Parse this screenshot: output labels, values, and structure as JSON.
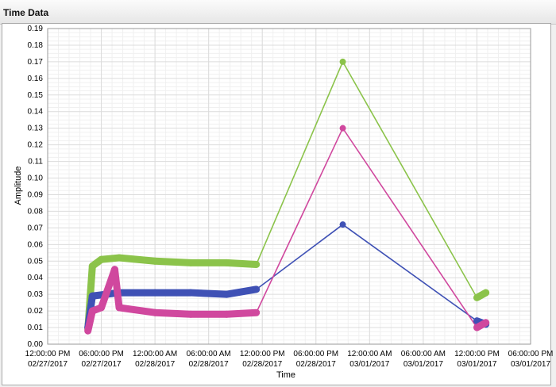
{
  "panel": {
    "title": "Time Data"
  },
  "chart_data": {
    "type": "scatter",
    "xlabel": "Time",
    "ylabel": "Amplitude",
    "xlim": [
      "2017-02-27 12:00",
      "2017-03-01 18:00"
    ],
    "ylim": [
      0,
      0.19
    ],
    "grid": true,
    "legend": "none",
    "x_ticks": [
      {
        "time": "2017-02-27 12:00",
        "l1": "12:00:00 PM",
        "l2": "02/27/2017"
      },
      {
        "time": "2017-02-27 18:00",
        "l1": "06:00:00 PM",
        "l2": "02/27/2017"
      },
      {
        "time": "2017-02-28 00:00",
        "l1": "12:00:00 AM",
        "l2": "02/28/2017"
      },
      {
        "time": "2017-02-28 06:00",
        "l1": "06:00:00 AM",
        "l2": "02/28/2017"
      },
      {
        "time": "2017-02-28 12:00",
        "l1": "12:00:00 PM",
        "l2": "02/28/2017"
      },
      {
        "time": "2017-02-28 18:00",
        "l1": "06:00:00 PM",
        "l2": "02/28/2017"
      },
      {
        "time": "2017-03-01 00:00",
        "l1": "12:00:00 AM",
        "l2": "03/01/2017"
      },
      {
        "time": "2017-03-01 06:00",
        "l1": "06:00:00 AM",
        "l2": "03/01/2017"
      },
      {
        "time": "2017-03-01 12:00",
        "l1": "12:00:00 PM",
        "l2": "03/01/2017"
      },
      {
        "time": "2017-03-01 18:00",
        "l1": "06:00:00 PM",
        "l2": "03/01/2017"
      }
    ],
    "y_ticks": [
      "0.00",
      "0.01",
      "0.02",
      "0.03",
      "0.04",
      "0.05",
      "0.06",
      "0.07",
      "0.08",
      "0.09",
      "0.10",
      "0.11",
      "0.12",
      "0.13",
      "0.14",
      "0.15",
      "0.16",
      "0.17",
      "0.18",
      "0.19"
    ],
    "series": [
      {
        "color": "#8bc34a",
        "points": [
          {
            "time": "2017-02-27 16:30",
            "y": 0.009
          },
          {
            "time": "2017-02-27 17:00",
            "y": 0.047
          },
          {
            "time": "2017-02-27 18:00",
            "y": 0.051
          },
          {
            "time": "2017-02-27 20:00",
            "y": 0.052
          },
          {
            "time": "2017-02-28 00:00",
            "y": 0.05
          },
          {
            "time": "2017-02-28 04:00",
            "y": 0.049
          },
          {
            "time": "2017-02-28 08:00",
            "y": 0.049
          },
          {
            "time": "2017-02-28 11:20",
            "y": 0.048
          },
          {
            "time": "2017-02-28 21:00",
            "y": 0.17
          },
          {
            "time": "2017-03-01 12:00",
            "y": 0.028
          },
          {
            "time": "2017-03-01 13:00",
            "y": 0.031
          }
        ]
      },
      {
        "color": "#3f51b5",
        "points": [
          {
            "time": "2017-02-27 16:30",
            "y": 0.01
          },
          {
            "time": "2017-02-27 17:00",
            "y": 0.029
          },
          {
            "time": "2017-02-27 20:00",
            "y": 0.031
          },
          {
            "time": "2017-02-28 00:00",
            "y": 0.031
          },
          {
            "time": "2017-02-28 04:00",
            "y": 0.031
          },
          {
            "time": "2017-02-28 08:00",
            "y": 0.03
          },
          {
            "time": "2017-02-28 11:20",
            "y": 0.033
          },
          {
            "time": "2017-02-28 21:00",
            "y": 0.072
          },
          {
            "time": "2017-03-01 12:00",
            "y": 0.014
          },
          {
            "time": "2017-03-01 13:00",
            "y": 0.012
          }
        ]
      },
      {
        "color": "#d0489e",
        "points": [
          {
            "time": "2017-02-27 16:30",
            "y": 0.008
          },
          {
            "time": "2017-02-27 17:00",
            "y": 0.02
          },
          {
            "time": "2017-02-27 18:00",
            "y": 0.022
          },
          {
            "time": "2017-02-27 19:30",
            "y": 0.045
          },
          {
            "time": "2017-02-27 20:00",
            "y": 0.022
          },
          {
            "time": "2017-02-28 00:00",
            "y": 0.019
          },
          {
            "time": "2017-02-28 04:00",
            "y": 0.018
          },
          {
            "time": "2017-02-28 08:00",
            "y": 0.018
          },
          {
            "time": "2017-02-28 11:20",
            "y": 0.019
          },
          {
            "time": "2017-02-28 21:00",
            "y": 0.13
          },
          {
            "time": "2017-03-01 12:00",
            "y": 0.01
          },
          {
            "time": "2017-03-01 13:00",
            "y": 0.013
          }
        ]
      }
    ]
  }
}
